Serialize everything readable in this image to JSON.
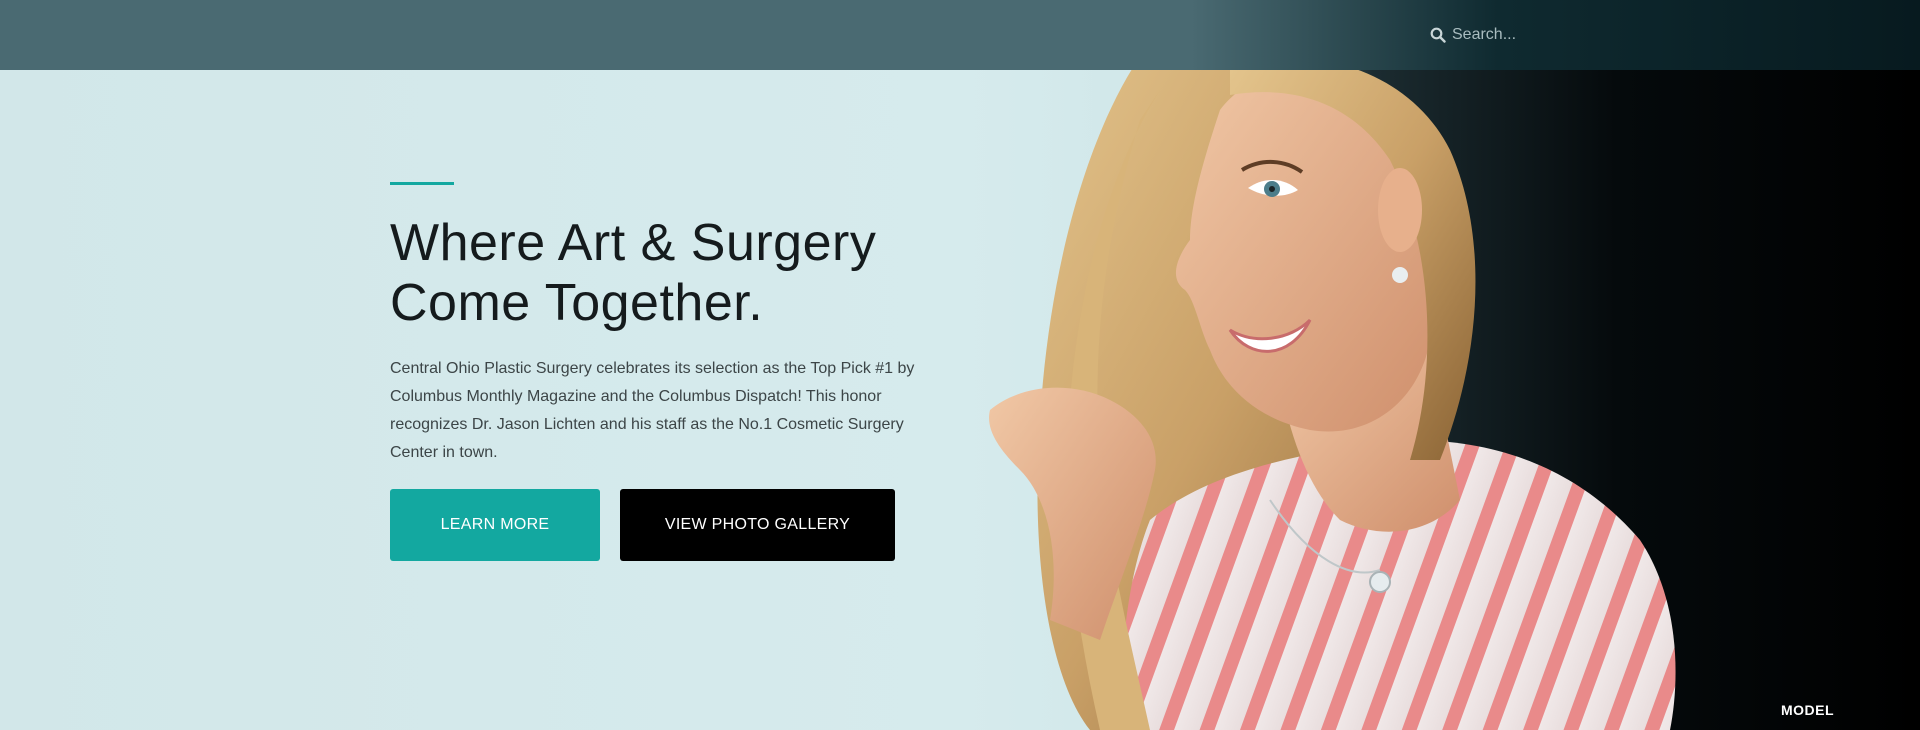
{
  "search": {
    "placeholder": "Search..."
  },
  "hero": {
    "headline_line1": "Where Art & Surgery",
    "headline_line2": "Come Together.",
    "body": "Central Ohio Plastic Surgery celebrates its selection as the Top Pick #1 by Columbus Monthly Magazine and the Columbus Dispatch! This honor recognizes Dr. Jason Lichten and his staff as the No.1 Cosmetic Surgery Center in town.",
    "learn_more_label": "LEARN MORE",
    "gallery_label": "VIEW PHOTO GALLERY",
    "photo_caption": "MODEL"
  },
  "colors": {
    "accent": "#13a8a0",
    "dark_button": "#000000",
    "topbar": "#4a6a72",
    "background": "#d3e8ea"
  },
  "icons": {
    "search": "search-icon"
  }
}
